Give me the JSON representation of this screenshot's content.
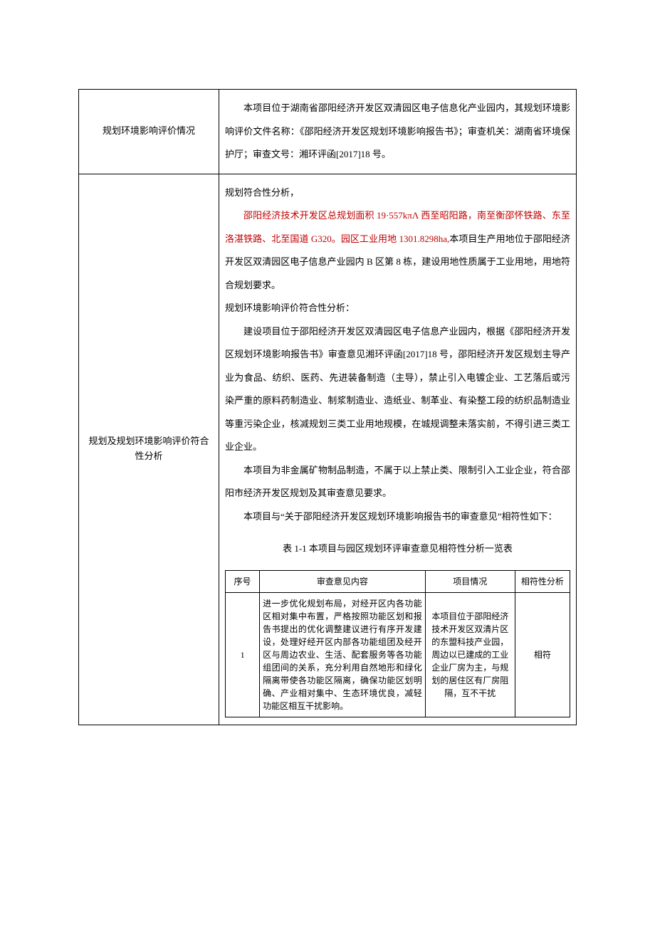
{
  "row1": {
    "label": "规划环境影响评价情况",
    "p1": "本项目位于湖南省邵阳经济开发区双清园区电子信息化产业园内，其规划环境影响评价文件名称：《邵阳经济开发区规划环境影响报告书》；审查机关：湖南省环境保护厅；审查文号：湘环评函[2017]18 号。"
  },
  "row2": {
    "label": "规划及规划环境影响评价符合性分析",
    "h1": "规划符合性分析，",
    "p_red": "邵阳经济技术开发区总规划面积 19·557kπΛ 西至昭阳路，南至衡邵怀铁路、东至洛湛铁路、北至国道 G320。园区工业用地 1301.8298ha,",
    "p_red_tail": "本项目生产用地位于邵阳经济开发区双清园区电子信息产业园内 B 区第 8 栋，建设用地性质属于工业用地，用地符合规划要求。",
    "h2": "规划环境影响评价符合性分析：",
    "p3": "建设项目位于邵阳经济开发区双清园区电子信息产业园内，根据《邵阳经济开发区规划环境影响报告书》审查意见湘环评函[2017]18 号，邵阳经济开发区规划主导产业为食品、纺织、医药、先进装备制造（主导），禁止引入电镀企业、工艺落后或污染严重的原料药制造业、制浆制造业、造纸业、制革业、有染整工段的纺织品制造业等重污染企业，核减规划三类工业用地规模，在城规调整未落实前，不得引进三类工业企业。",
    "p4": "本项目为非金属矿物制品制造，不属于以上禁止类、限制引入工业企业，符合邵阳市经济开发区规划及其审查意见要求。",
    "p5": "本项目与“关于邵阳经济开发区规划环境影响报告书的审查意见”相符性如下：",
    "table_caption": "表 1-1 本项目与园区规划环评审查意见相符性分析一览表",
    "headers": {
      "c1": "序号",
      "c2": "审查意见内容",
      "c3": "项目情况",
      "c4": "相符性分析"
    },
    "trow1": {
      "seq": "1",
      "opinion": "进一步优化规划布局，对经开区内各功能区相对集中布置，严格按照功能区划和报告书提出的优化调整建议进行有序开发建设，处理好经开区内部各功能组团及经开区与周边农业、生活、配套服务等各功能组团间的关系，充分利用自然地形和绿化隔离带使各功能区隔离，确保功能区划明确、产业相对集中、生态环境优良，减轻功能区相互干扰影响。",
      "proj": "本项目位于邵阳经济技术开发区双清片区的东盟科技产业园，周边以已建成的工业企业厂房为主，与规划的居住区有厂房阻隔，互不干扰",
      "compat": "相符"
    }
  }
}
